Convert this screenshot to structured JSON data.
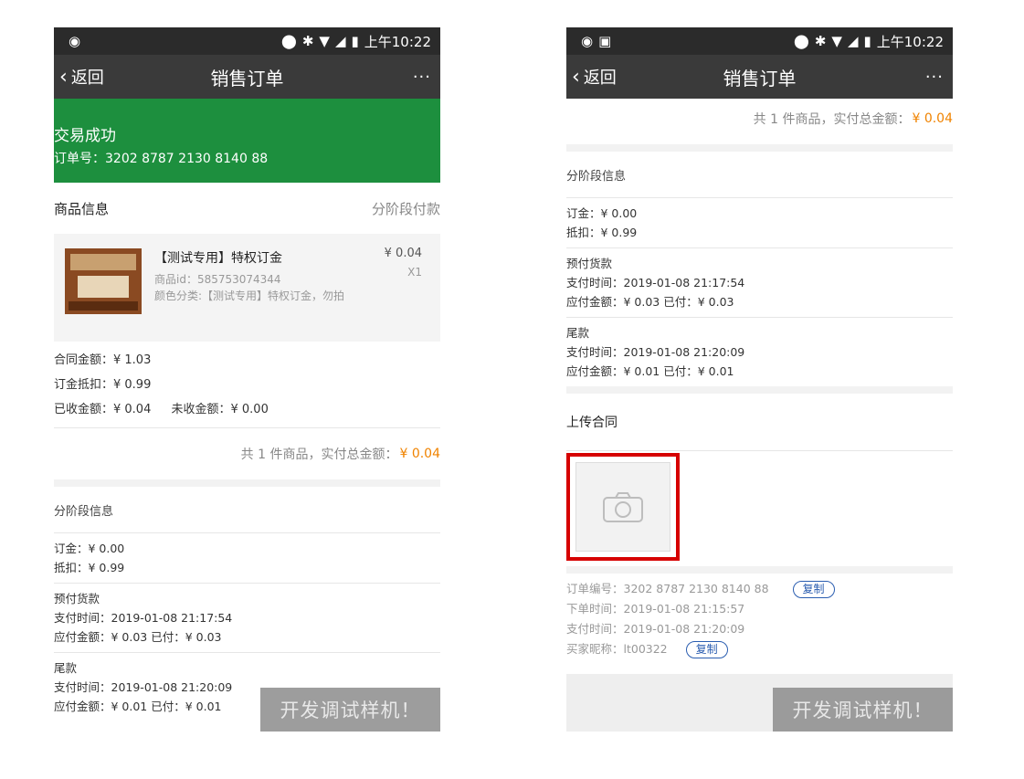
{
  "status": {
    "time": "上午10:22"
  },
  "nav": {
    "back": "返回",
    "title": "销售订单",
    "more": "···"
  },
  "left": {
    "success_title": "交易成功",
    "order_no": "订单号：3202 8787 2130 8140 88",
    "goods_header": "商品信息",
    "goods_mode": "分阶段付款",
    "product": {
      "name": "【测试专用】特权订金",
      "price": "¥ 0.04",
      "qty": "X1",
      "id": "商品id：585753074344",
      "variant": "颜色分类:【测试专用】特权订金，勿拍"
    },
    "contract_amount": "合同金额：¥ 1.03",
    "deposit_deduct": "订金抵扣：¥ 0.99",
    "received": "已收金额：¥ 0.04",
    "unreceived": "未收金额：¥ 0.00",
    "total_prefix": "共 1 件商品，实付总金额：",
    "total_amount": "¥ 0.04",
    "stage_header": "分阶段信息",
    "deposit": {
      "l1": "订金：¥ 0.00",
      "l2": "抵扣：¥ 0.99"
    },
    "prepay": {
      "title": "预付货款",
      "time": "支付时间：2019-01-08 21:17:54",
      "amount": "应付金额：¥ 0.03   已付：¥ 0.03"
    },
    "final": {
      "title": "尾款",
      "time": "支付时间：2019-01-08 21:20:09",
      "amount": "应付金额：¥ 0.01   已付：¥ 0.01"
    },
    "debug": "开发调试样机！"
  },
  "right": {
    "total_prefix": "共 1 件商品，实付总金额：",
    "total_amount": "¥ 0.04",
    "stage_header": "分阶段信息",
    "deposit": {
      "l1": "订金：¥ 0.00",
      "l2": "抵扣：¥ 0.99"
    },
    "prepay": {
      "title": "预付货款",
      "time": "支付时间：2019-01-08 21:17:54",
      "amount": "应付金额：¥ 0.03   已付：¥ 0.03"
    },
    "final": {
      "title": "尾款",
      "time": "支付时间：2019-01-08 21:20:09",
      "amount": "应付金额：¥ 0.01   已付：¥ 0.01"
    },
    "upload_header": "上传合同",
    "order_number": "订单编号：3202 8787 2130 8140 88",
    "order_time": "下单时间：2019-01-08 21:15:57",
    "pay_time": "支付时间：2019-01-08 21:20:09",
    "buyer": "买家昵称：lt00322",
    "copy": "复制",
    "debug": "开发调试样机！"
  },
  "colors": {
    "success": "#1d8f3e",
    "accent": "#f08300",
    "highlight": "#d60000",
    "link": "#2a5db0"
  }
}
